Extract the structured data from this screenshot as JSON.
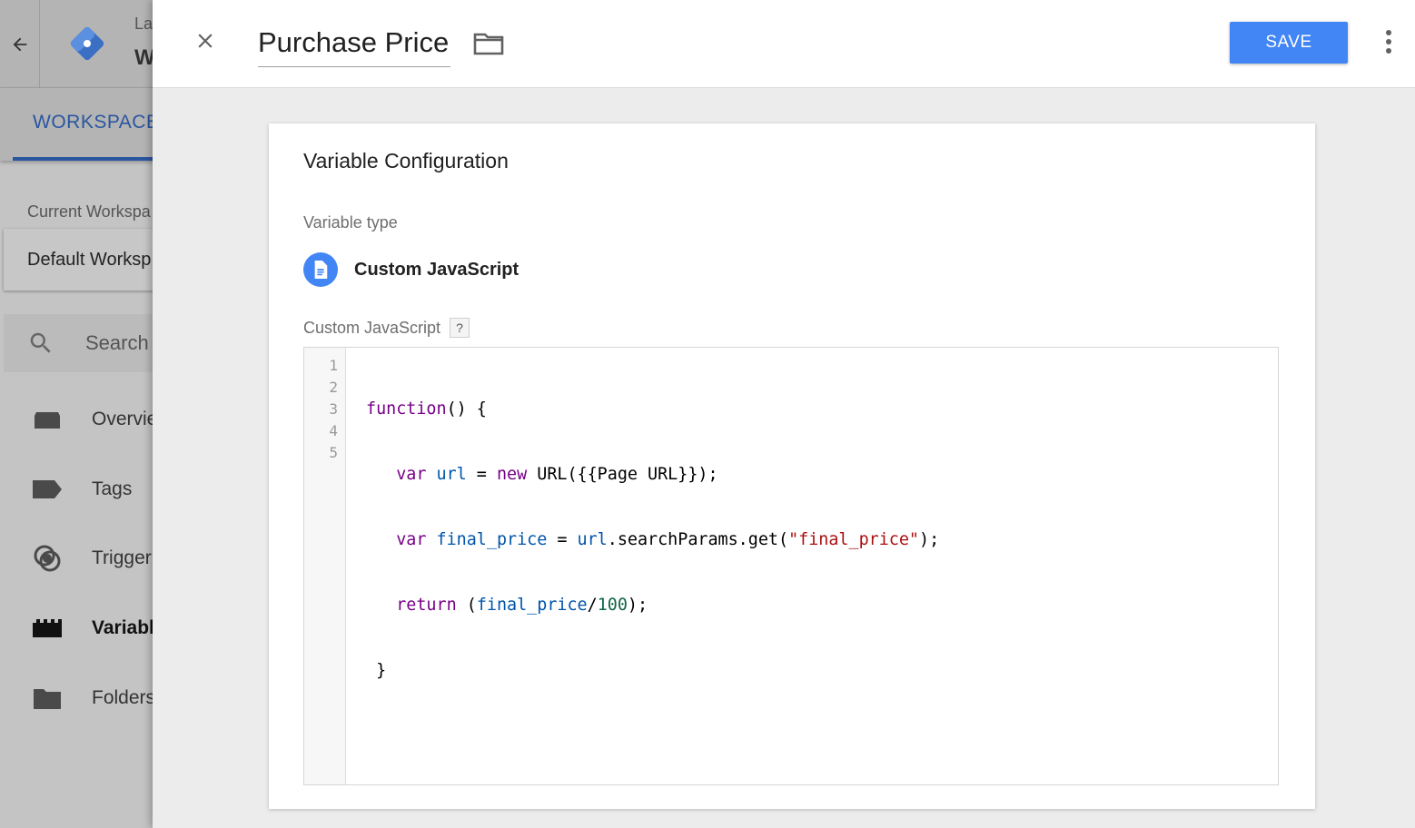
{
  "background": {
    "account_name": "La",
    "container_name": "W",
    "tab_label": "WORKSPACE",
    "workspace_label": "Current Workspa",
    "workspace_value": "Default Worksp",
    "search_placeholder": "Search",
    "nav_items": [
      {
        "label": "Overvie",
        "icon": "overview-icon"
      },
      {
        "label": "Tags",
        "icon": "tag-icon"
      },
      {
        "label": "Trigger",
        "icon": "trigger-icon"
      },
      {
        "label": "Variabl",
        "icon": "variables-icon",
        "active": true
      },
      {
        "label": "Folders",
        "icon": "folder-icon"
      }
    ]
  },
  "panel": {
    "title": "Purchase Price",
    "save_label": "SAVE",
    "card": {
      "title": "Variable Configuration",
      "variable_type_label": "Variable type",
      "variable_type_name": "Custom JavaScript",
      "code_label": "Custom JavaScript",
      "help_label": "?",
      "line_numbers": [
        "1",
        "2",
        "3",
        "4",
        "5"
      ],
      "code": {
        "l1_kw": "function",
        "l1_rest": "() {",
        "l2_kw1": "var",
        "l2_def": "url",
        "l2_eq": " = ",
        "l2_kw2": "new",
        "l2_rest": " URL({{Page URL}});",
        "l3_kw": "var",
        "l3_def": "final_price",
        "l3_eq": " = ",
        "l3_var": "url",
        "l3_call": ".searchParams.get(",
        "l3_str": "\"final_price\"",
        "l3_end": ");",
        "l4_kw": "return",
        "l4_open": " (",
        "l4_var": "final_price",
        "l4_div": "/",
        "l4_num": "100",
        "l4_end": ");",
        "l5": " }"
      }
    }
  },
  "colors": {
    "accent": "#4285f4",
    "keyword": "#770088",
    "variable": "#0055aa",
    "string": "#aa1111",
    "number": "#116644"
  }
}
